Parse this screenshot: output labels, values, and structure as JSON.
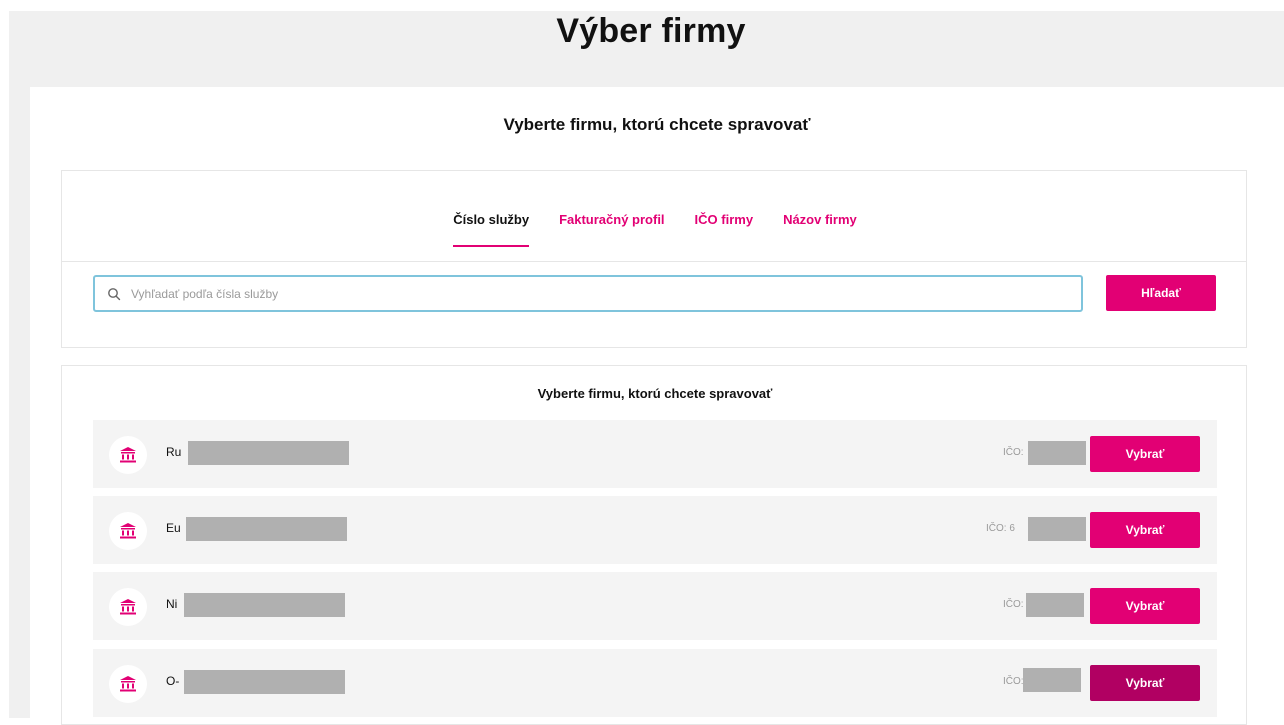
{
  "page_title": "Výber firmy",
  "card_subtitle": "Vyberte firmu, ktorú chcete spravovať",
  "tabs": [
    {
      "label": "Číslo služby",
      "active": true
    },
    {
      "label": "Fakturačný profil",
      "active": false
    },
    {
      "label": "IČO firmy",
      "active": false
    },
    {
      "label": "Názov firmy",
      "active": false
    }
  ],
  "search": {
    "placeholder": "Vyhľadať podľa čísla služby",
    "value": "",
    "button_label": "Hľadať"
  },
  "results": {
    "title": "Vyberte firmu, ktorú chcete spravovať",
    "companies": [
      {
        "name_prefix": "Ru",
        "ico_label": "IČO:",
        "button_label": "Vybrať"
      },
      {
        "name_prefix": "Eu",
        "ico_label": "IČO: 6",
        "button_label": "Vybrať"
      },
      {
        "name_prefix": "Ni",
        "ico_label": "IČO:",
        "button_label": "Vybrať"
      },
      {
        "name_prefix": "O-",
        "ico_label": "IČO:",
        "button_label": "Vybrať"
      }
    ]
  },
  "colors": {
    "accent": "#e20074",
    "accent_hover": "#b10062",
    "row_bg": "#f4f4f4",
    "redaction": "#b0b0b0"
  },
  "icons": {
    "search": "search-icon",
    "company": "bank-building-icon"
  }
}
